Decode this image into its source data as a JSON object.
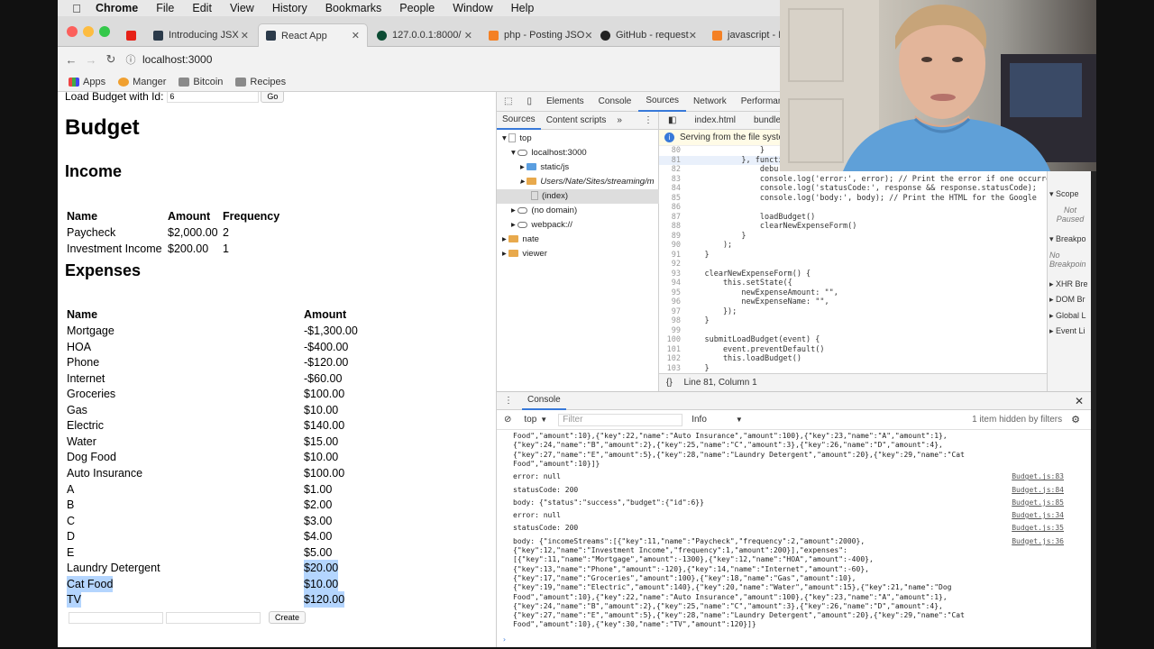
{
  "menubar": {
    "app_name": "Chrome",
    "items": [
      "File",
      "Edit",
      "View",
      "History",
      "Bookmarks",
      "People",
      "Window",
      "Help"
    ]
  },
  "tabs": [
    {
      "label": "",
      "active": false
    },
    {
      "label": "Introducing JSX",
      "active": false
    },
    {
      "label": "React App",
      "active": true
    },
    {
      "label": "127.0.0.1:8000/",
      "active": false
    },
    {
      "label": "php - Posting JSO",
      "active": false
    },
    {
      "label": "GitHub - request",
      "active": false
    },
    {
      "label": "javascript - H",
      "active": false
    }
  ],
  "address": {
    "url": "localhost:3000"
  },
  "bookmarks": [
    "Apps",
    "Manger",
    "Bitcoin",
    "Recipes"
  ],
  "page": {
    "load_label": "Load Budget with Id:",
    "load_value": "6",
    "go_label": "Go",
    "title": "Budget",
    "income_heading": "Income",
    "income_headers": [
      "Name",
      "Amount",
      "Frequency"
    ],
    "income_rows": [
      {
        "name": "Paycheck",
        "amount": "$2,000.00",
        "frequency": "2"
      },
      {
        "name": "Investment Income",
        "amount": "$200.00",
        "frequency": "1"
      }
    ],
    "expenses_heading": "Expenses",
    "expense_headers": [
      "Name",
      "Amount"
    ],
    "expense_rows": [
      {
        "name": "Mortgage",
        "amount": "-$1,300.00"
      },
      {
        "name": "HOA",
        "amount": "-$400.00"
      },
      {
        "name": "Phone",
        "amount": "-$120.00"
      },
      {
        "name": "Internet",
        "amount": "-$60.00"
      },
      {
        "name": "Groceries",
        "amount": "$100.00"
      },
      {
        "name": "Gas",
        "amount": "$10.00"
      },
      {
        "name": "Electric",
        "amount": "$140.00"
      },
      {
        "name": "Water",
        "amount": "$15.00"
      },
      {
        "name": "Dog Food",
        "amount": "$10.00"
      },
      {
        "name": "Auto Insurance",
        "amount": "$100.00"
      },
      {
        "name": "A",
        "amount": "$1.00"
      },
      {
        "name": "B",
        "amount": "$2.00"
      },
      {
        "name": "C",
        "amount": "$3.00"
      },
      {
        "name": "D",
        "amount": "$4.00"
      },
      {
        "name": "E",
        "amount": "$5.00"
      },
      {
        "name": "Laundry Detergent",
        "amount": "$20.00"
      },
      {
        "name": "Cat Food",
        "amount": "$10.00"
      },
      {
        "name": "TV",
        "amount": "$120.00"
      }
    ],
    "create_label": "Create"
  },
  "devtools": {
    "top_tabs": [
      "Elements",
      "Console",
      "Sources",
      "Network",
      "Performan"
    ],
    "nav_tabs": [
      "Sources",
      "Content scripts"
    ],
    "tree": [
      "top",
      "localhost:3000",
      "static/js",
      "Users/Nate/Sites/streaming/m",
      "(index)",
      "(no domain)",
      "webpack://",
      "nate",
      "viewer"
    ],
    "editor_tabs": [
      "index.html",
      "bundle.js"
    ],
    "banner": "Serving from the file syster",
    "code_lines": [
      {
        "n": "80",
        "t": "                }"
      },
      {
        "n": "81",
        "t": "            }, functi"
      },
      {
        "n": "82",
        "t": "                debu"
      },
      {
        "n": "83",
        "t": "                console.log('error:', error); // Print the error if one occurred"
      },
      {
        "n": "84",
        "t": "                console.log('statusCode:', response && response.statusCode);"
      },
      {
        "n": "85",
        "t": "                console.log('body:', body); // Print the HTML for the Google"
      },
      {
        "n": "86",
        "t": ""
      },
      {
        "n": "87",
        "t": "                loadBudget()"
      },
      {
        "n": "88",
        "t": "                clearNewExpenseForm()"
      },
      {
        "n": "89",
        "t": "            }"
      },
      {
        "n": "90",
        "t": "        );"
      },
      {
        "n": "91",
        "t": "    }"
      },
      {
        "n": "92",
        "t": ""
      },
      {
        "n": "93",
        "t": "    clearNewExpenseForm() {"
      },
      {
        "n": "94",
        "t": "        this.setState({"
      },
      {
        "n": "95",
        "t": "            newExpenseAmount: \"\","
      },
      {
        "n": "96",
        "t": "            newExpenseName: \"\","
      },
      {
        "n": "97",
        "t": "        });"
      },
      {
        "n": "98",
        "t": "    }"
      },
      {
        "n": "99",
        "t": ""
      },
      {
        "n": "100",
        "t": "    submitLoadBudget(event) {"
      },
      {
        "n": "101",
        "t": "        event.preventDefault()"
      },
      {
        "n": "102",
        "t": "        this.loadBudget()"
      },
      {
        "n": "103",
        "t": "    }"
      }
    ],
    "status": "Line 81, Column 1",
    "debugger": [
      "Scope",
      "Not Paused",
      "Breakpo",
      "No Breakpoin",
      "XHR Bre",
      "DOM Br",
      "Global L",
      "Event Li"
    ],
    "console": {
      "title": "Console",
      "context": "top",
      "filter_placeholder": "Filter",
      "level": "Info",
      "hidden": "1 item hidden by filters",
      "lines": [
        {
          "t": "Food\",\"amount\":10},{\"key\":22,\"name\":\"Auto Insurance\",\"amount\":100},{\"key\":23,\"name\":\"A\",\"amount\":1},",
          "src": ""
        },
        {
          "t": "{\"key\":24,\"name\":\"B\",\"amount\":2},{\"key\":25,\"name\":\"C\",\"amount\":3},{\"key\":26,\"name\":\"D\",\"amount\":4},",
          "src": ""
        },
        {
          "t": "{\"key\":27,\"name\":\"E\",\"amount\":5},{\"key\":28,\"name\":\"Laundry Detergent\",\"amount\":20},{\"key\":29,\"name\":\"Cat",
          "src": ""
        },
        {
          "t": "Food\",\"amount\":10}]}",
          "src": ""
        },
        {
          "t": "error: null",
          "src": "Budget.js:83"
        },
        {
          "t": "statusCode: 200",
          "src": "Budget.js:84"
        },
        {
          "t": "body: {\"status\":\"success\",\"budget\":{\"id\":6}}",
          "src": "Budget.js:85"
        },
        {
          "t": "error: null",
          "src": "Budget.js:34"
        },
        {
          "t": "statusCode: 200",
          "src": "Budget.js:35"
        },
        {
          "t": "body: {\"incomeStreams\":[{\"key\":11,\"name\":\"Paycheck\",\"frequency\":2,\"amount\":2000},",
          "src": "Budget.js:36"
        },
        {
          "t": "{\"key\":12,\"name\":\"Investment Income\",\"frequency\":1,\"amount\":200}],\"expenses\":",
          "src": ""
        },
        {
          "t": "[{\"key\":11,\"name\":\"Mortgage\",\"amount\":-1300},{\"key\":12,\"name\":\"HOA\",\"amount\":-400},",
          "src": ""
        },
        {
          "t": "{\"key\":13,\"name\":\"Phone\",\"amount\":-120},{\"key\":14,\"name\":\"Internet\",\"amount\":-60},",
          "src": ""
        },
        {
          "t": "{\"key\":17,\"name\":\"Groceries\",\"amount\":100},{\"key\":18,\"name\":\"Gas\",\"amount\":10},",
          "src": ""
        },
        {
          "t": "{\"key\":19,\"name\":\"Electric\",\"amount\":140},{\"key\":20,\"name\":\"Water\",\"amount\":15},{\"key\":21,\"name\":\"Dog",
          "src": ""
        },
        {
          "t": "Food\",\"amount\":10},{\"key\":22,\"name\":\"Auto Insurance\",\"amount\":100},{\"key\":23,\"name\":\"A\",\"amount\":1},",
          "src": ""
        },
        {
          "t": "{\"key\":24,\"name\":\"B\",\"amount\":2},{\"key\":25,\"name\":\"C\",\"amount\":3},{\"key\":26,\"name\":\"D\",\"amount\":4},",
          "src": ""
        },
        {
          "t": "{\"key\":27,\"name\":\"E\",\"amount\":5},{\"key\":28,\"name\":\"Laundry Detergent\",\"amount\":20},{\"key\":29,\"name\":\"Cat",
          "src": ""
        },
        {
          "t": "Food\",\"amount\":10},{\"key\":30,\"name\":\"TV\",\"amount\":120}]}",
          "src": ""
        }
      ]
    }
  },
  "colors": {
    "selection": "#b4d5fe",
    "active_tab_accent": "#3879d9"
  }
}
